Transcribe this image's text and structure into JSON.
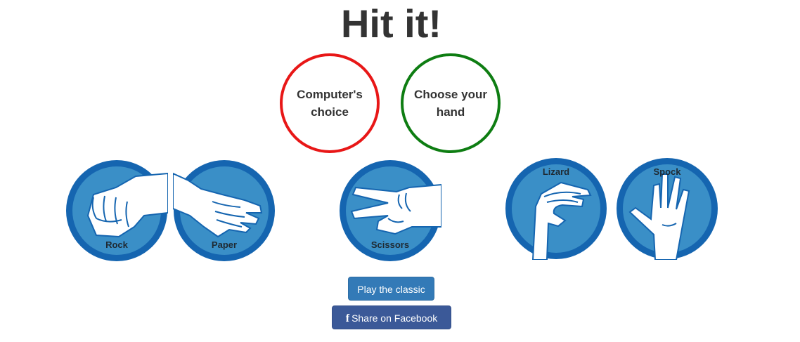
{
  "title": "Hit it!",
  "computer_choice": {
    "label": "Computer's choice",
    "border_color": "#e81717"
  },
  "player_choice": {
    "label": "Choose your hand",
    "border_color": "#0e7d12"
  },
  "hands": {
    "rock": {
      "label": "Rock",
      "icon": "rock-fist-icon"
    },
    "paper": {
      "label": "Paper",
      "icon": "paper-open-hand-icon"
    },
    "scissors": {
      "label": "Scissors",
      "icon": "scissors-hand-icon"
    },
    "lizard": {
      "label": "Lizard",
      "icon": "lizard-hand-icon"
    },
    "spock": {
      "label": "Spock",
      "icon": "spock-vulcan-hand-icon"
    }
  },
  "buttons": {
    "classic": "Play the classic",
    "facebook": "Share on Facebook",
    "facebook_icon": "f"
  },
  "colors": {
    "circle_outer": "#1565b0",
    "circle_inner": "#3a8fc7",
    "classic_button": "#337ab7",
    "facebook_button": "#3b5998"
  }
}
